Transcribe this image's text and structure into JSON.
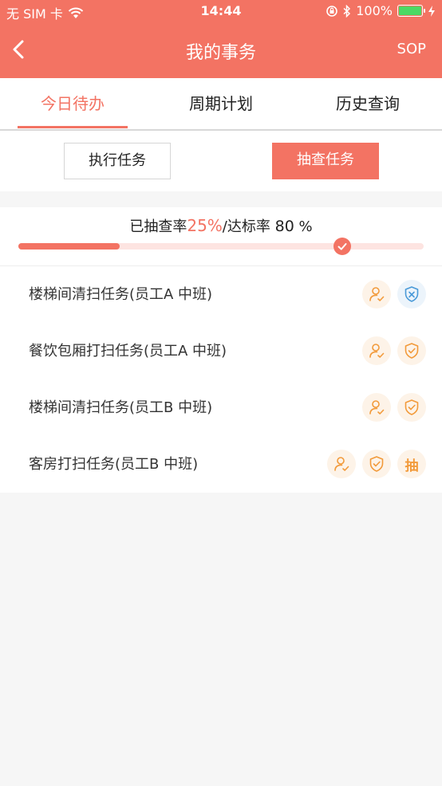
{
  "status_bar": {
    "carrier": "无 SIM 卡",
    "time": "14:44",
    "battery": "100%"
  },
  "nav": {
    "title": "我的事务",
    "right_action": "SOP"
  },
  "tabs": [
    {
      "label": "今日待办",
      "active": true
    },
    {
      "label": "周期计划",
      "active": false
    },
    {
      "label": "历史查询",
      "active": false
    }
  ],
  "mode_buttons": {
    "execute": "执行任务",
    "spot_check": "抽查任务"
  },
  "progress": {
    "prefix": "已抽查率",
    "checked_rate": "25%",
    "separator": "/达标率",
    "target_value": "80",
    "target_unit": "%",
    "checked_fraction": 0.25,
    "target_fraction": 0.8
  },
  "tasks": [
    {
      "title": "楼梯间清扫任务(员工A  中班)",
      "actions": [
        "person-check-icon",
        "shield-x-icon"
      ]
    },
    {
      "title": "餐饮包厢打扫任务(员工A  中班)",
      "actions": [
        "person-check-icon",
        "shield-check-icon"
      ]
    },
    {
      "title": "楼梯间清扫任务(员工B  中班)",
      "actions": [
        "person-check-icon",
        "shield-check-icon"
      ]
    },
    {
      "title": "客房打扫任务(员工B  中班)",
      "actions": [
        "person-check-icon",
        "shield-check-icon",
        "spot-check-label"
      ],
      "spot_check_label": "抽"
    }
  ],
  "colors": {
    "primary": "#f37363",
    "action_orange": "#f29a3a",
    "action_blue": "#4a9ad8",
    "battery": "#4cd964"
  }
}
